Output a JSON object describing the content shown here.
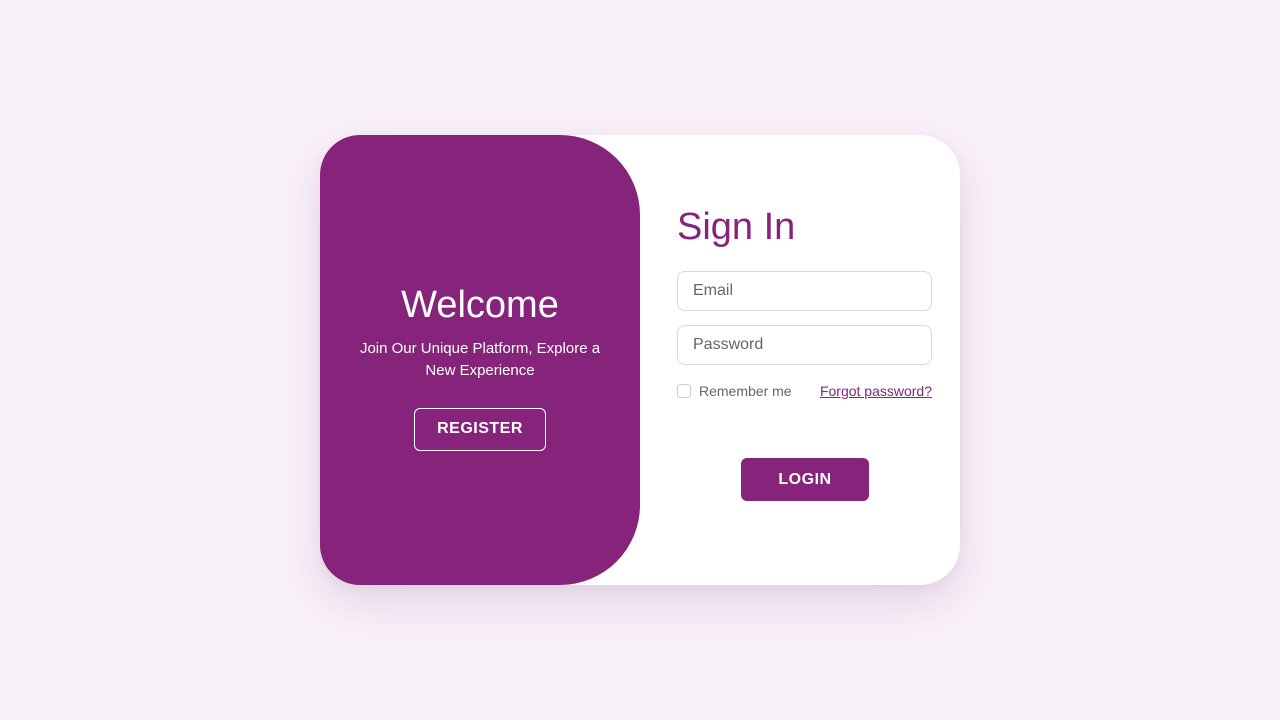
{
  "welcome": {
    "title": "Welcome",
    "text": "Join Our Unique Platform, Explore a New Experience",
    "register_label": "REGISTER"
  },
  "signin": {
    "title": "Sign In",
    "email_placeholder": "Email",
    "password_placeholder": "Password",
    "remember_label": "Remember me",
    "forgot_label": "Forgot password?",
    "login_label": "LOGIN"
  },
  "colors": {
    "brand": "#85247a",
    "page_background": "#f9f1f9",
    "card_background": "#ffffff"
  }
}
